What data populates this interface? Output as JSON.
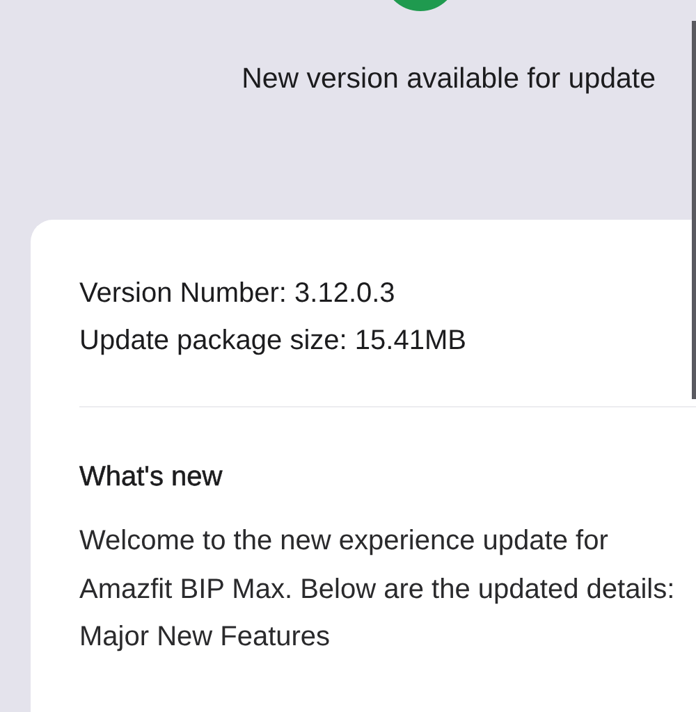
{
  "header": {
    "message": "New version available for update"
  },
  "details": {
    "version": "Version Number: 3.12.0.3",
    "size": "Update package size: 15.41MB"
  },
  "whats_new": {
    "title": "What's new",
    "description": "Welcome to the new experience update for Amazfit BIP Max. Below are the updated details:",
    "section": "Major New Features"
  }
}
